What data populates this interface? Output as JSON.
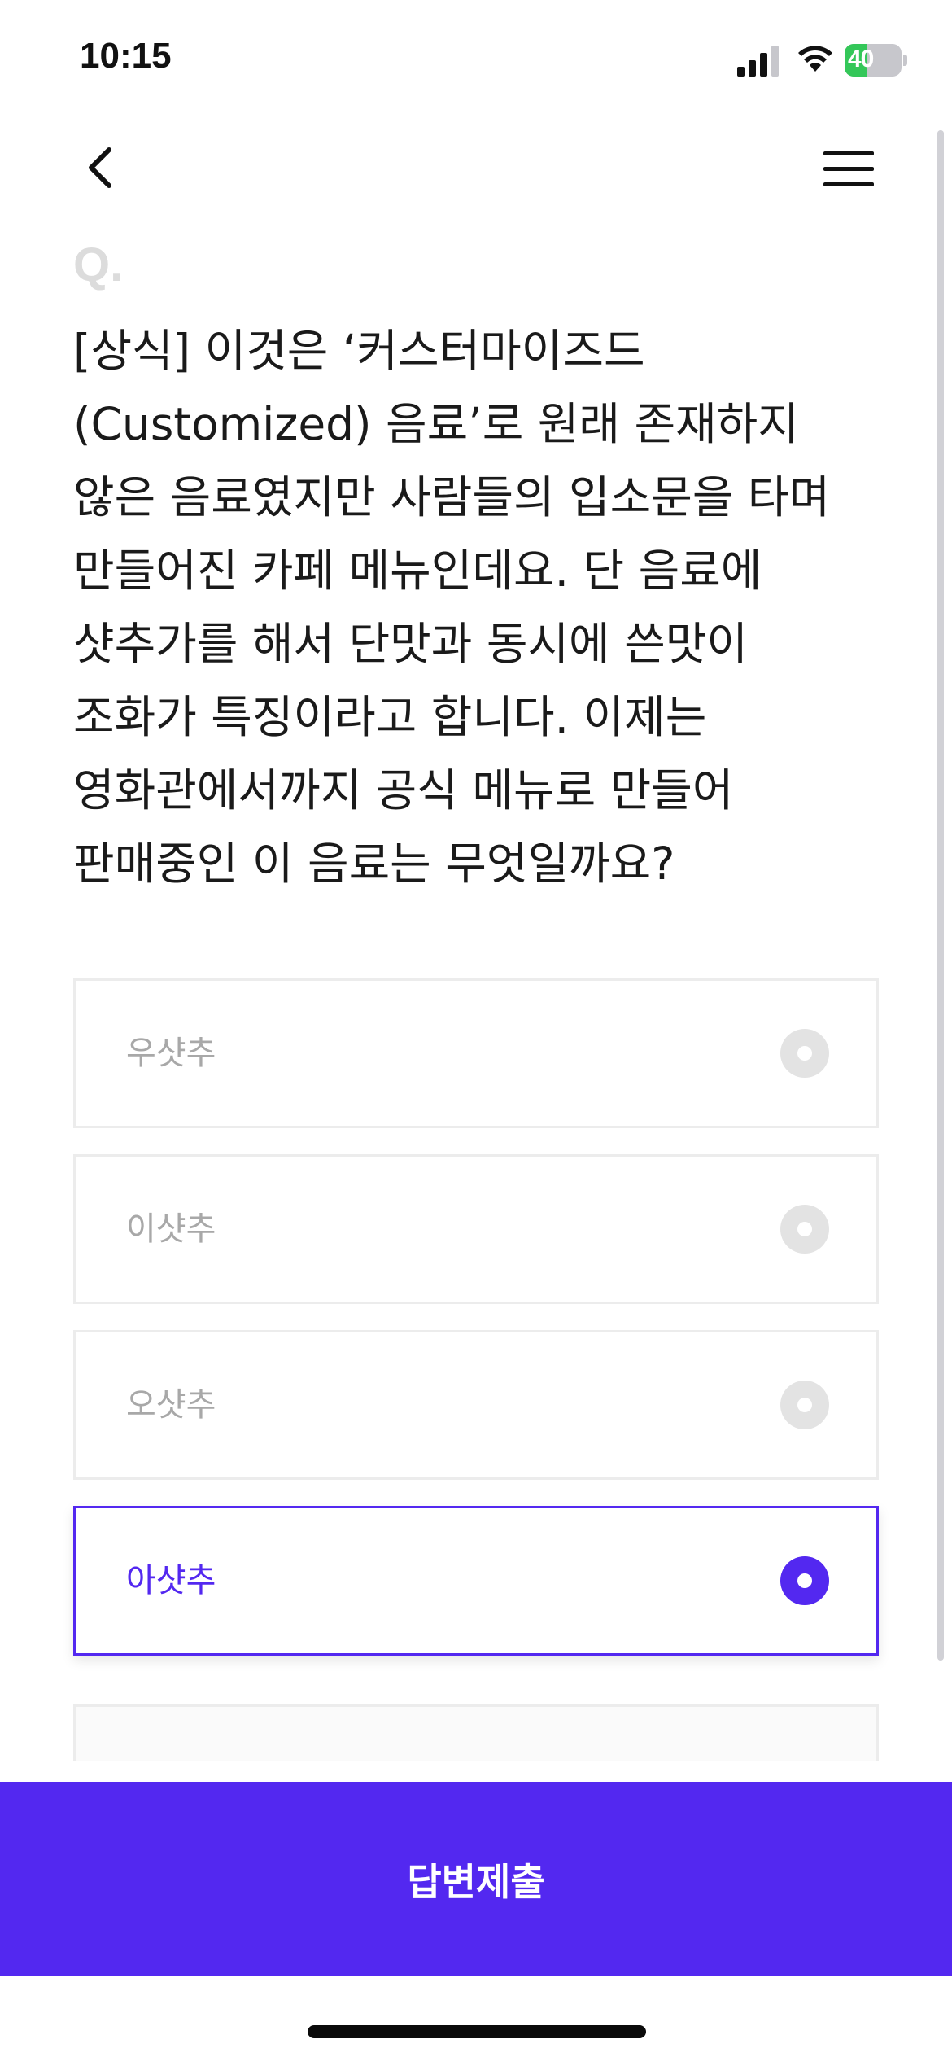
{
  "status_bar": {
    "time": "10:15",
    "battery_percent": "40",
    "battery_level": 0.4,
    "icons": [
      "cellular-signal-icon",
      "wifi-icon",
      "battery-icon"
    ]
  },
  "nav": {
    "back_icon": "chevron-left-icon",
    "menu_icon": "hamburger-menu-icon"
  },
  "question": {
    "marker": "Q.",
    "text": "[상식] 이것은 ‘커스터마이즈드(Customized) 음료’로 원래 존재하지 않은 음료였지만 사람들의 입소문을 타며 만들어진 카페 메뉴인데요. 단 음료에 샷추가를 해서 단맛과 동시에 쓴맛이 조화가 특징이라고 합니다. 이제는 영화관에서까지 공식 메뉴로 만들어 판매중인 이 음료는 무엇일까요?"
  },
  "answers": [
    {
      "label": "우샷추",
      "selected": false
    },
    {
      "label": "이샷추",
      "selected": false
    },
    {
      "label": "오샷추",
      "selected": false
    },
    {
      "label": "아샷추",
      "selected": true
    }
  ],
  "submit": {
    "label": "답변제출"
  },
  "colors": {
    "accent": "#5328f0",
    "option_border": "#ececec",
    "option_text": "#a8a8a8",
    "radio_inactive": "#e3e3e3",
    "battery_fill": "#34c759"
  }
}
